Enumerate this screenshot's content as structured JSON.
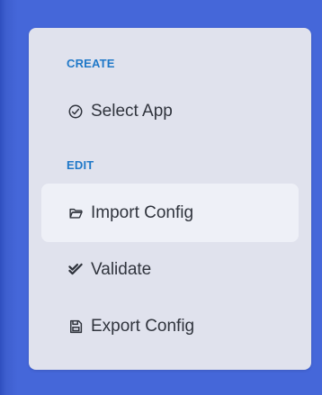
{
  "menu": {
    "sections": [
      {
        "title": "CREATE",
        "items": [
          {
            "label": "Select App",
            "icon": "check-circle-icon",
            "active": false
          }
        ]
      },
      {
        "title": "EDIT",
        "items": [
          {
            "label": "Import Config",
            "icon": "folder-open-icon",
            "active": true
          },
          {
            "label": "Validate",
            "icon": "double-check-icon",
            "active": false
          },
          {
            "label": "Export Config",
            "icon": "save-icon",
            "active": false
          }
        ]
      }
    ]
  },
  "colors": {
    "background": "#4567d9",
    "panel": "#e0e2ed",
    "section_header": "#1f78c8",
    "item_text": "#30343d",
    "active_item_bg": "#eef0f7"
  }
}
